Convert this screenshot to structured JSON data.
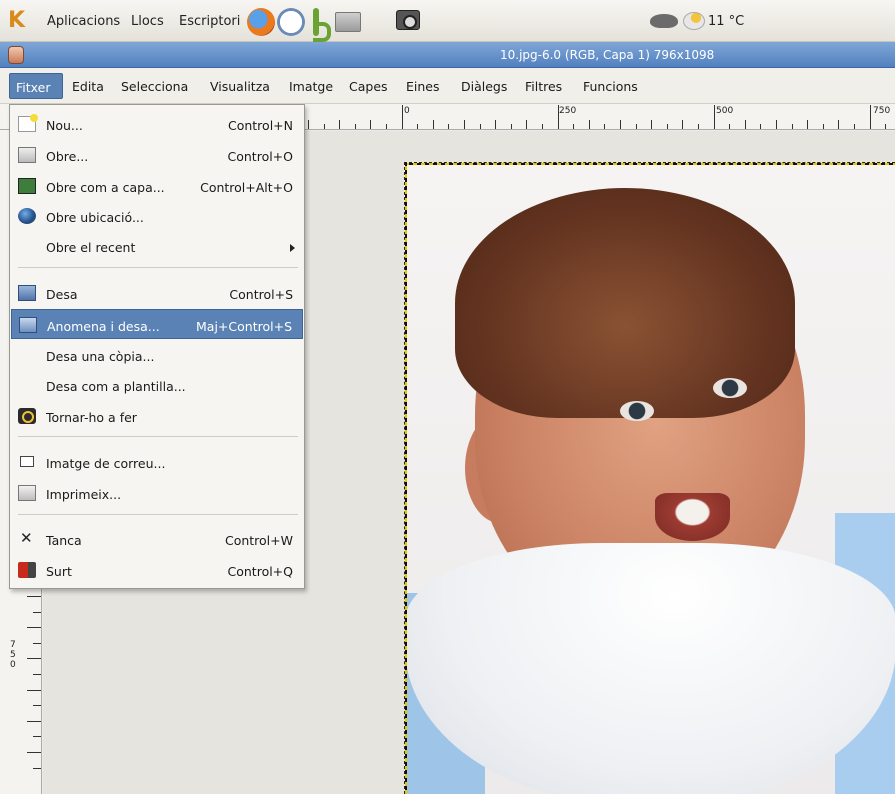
{
  "panel": {
    "menu": [
      "Aplicacions",
      "Llocs",
      "Escriptori"
    ],
    "launchers": [
      "firefox-icon",
      "clock-icon",
      "green-icon",
      "folder-icon",
      "camera-icon"
    ],
    "temperature": "11 °C"
  },
  "window": {
    "title": "10.jpg-6.0 (RGB, Capa 1) 796x1098"
  },
  "menubar": {
    "items": [
      "Fitxer",
      "Edita",
      "Selecciona",
      "Visualitza",
      "Imatge",
      "Capes",
      "Eines",
      "Diàlegs",
      "Filtres",
      "Funcions"
    ],
    "active": "Fitxer"
  },
  "ruler": {
    "top_labels": [
      "0",
      "250",
      "500",
      "750"
    ],
    "left_label": "750"
  },
  "file_menu": {
    "items": [
      {
        "label": "Nou...",
        "accel": "Control+N",
        "icon": "new-icon"
      },
      {
        "label": "Obre...",
        "accel": "Control+O",
        "icon": "open-icon"
      },
      {
        "label": "Obre com a capa...",
        "accel": "Control+Alt+O",
        "icon": "open-layer-icon"
      },
      {
        "label": "Obre ubicació...",
        "accel": "",
        "icon": "globe-icon"
      },
      {
        "label": "Obre el recent",
        "accel": "",
        "icon": "",
        "submenu": true
      },
      {
        "label": "Desa",
        "accel": "Control+S",
        "icon": "save-icon"
      },
      {
        "label": "Anomena i desa...",
        "accel": "Maj+Control+S",
        "icon": "save-as-icon",
        "selected": true
      },
      {
        "label": "Desa una còpia...",
        "accel": "",
        "icon": ""
      },
      {
        "label": "Desa com a plantilla...",
        "accel": "",
        "icon": ""
      },
      {
        "label": "Tornar-ho a fer",
        "accel": "",
        "icon": "revert-icon"
      },
      {
        "label": "Imatge de correu...",
        "accel": "",
        "icon": "mail-icon"
      },
      {
        "label": "Imprimeix...",
        "accel": "",
        "icon": "print-icon"
      },
      {
        "label": "Tanca",
        "accel": "Control+W",
        "icon": "close-icon",
        "glyph": "✕"
      },
      {
        "label": "Surt",
        "accel": "Control+Q",
        "icon": "quit-icon"
      }
    ]
  },
  "colors": {
    "selection": "#5a82b4",
    "titlebar": "#5a86c4"
  }
}
